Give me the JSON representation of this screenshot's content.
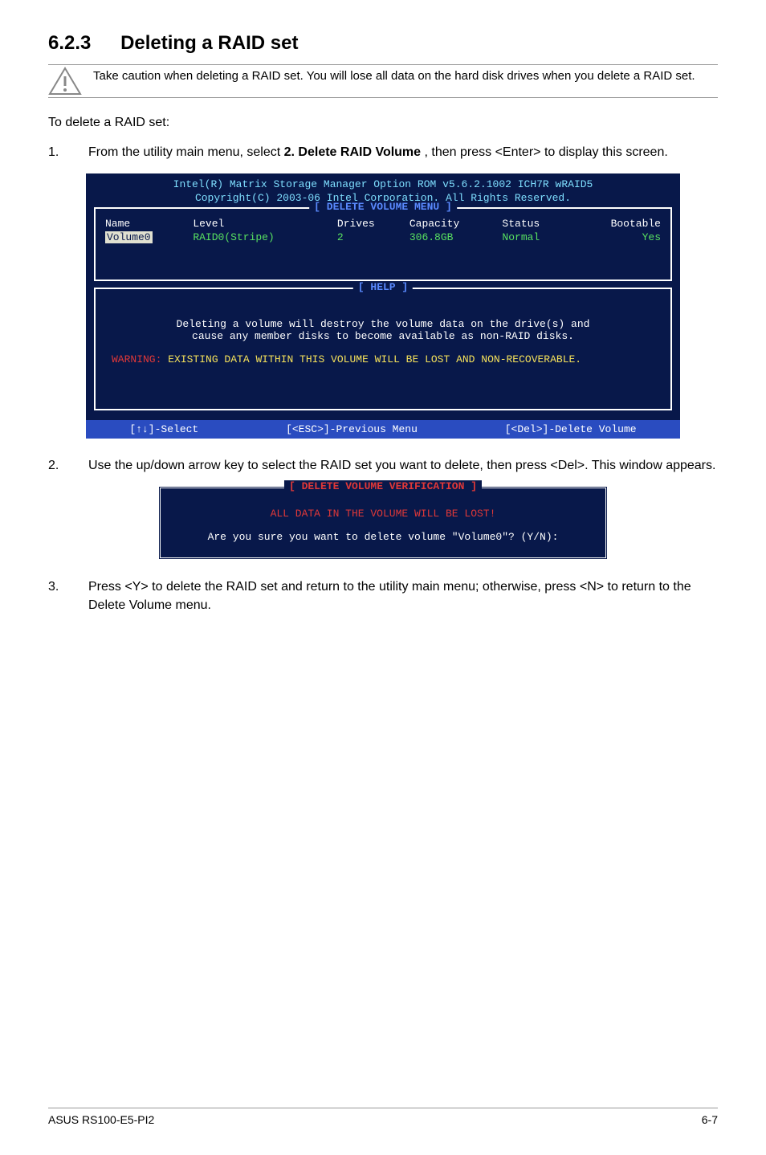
{
  "heading": {
    "number": "6.2.3",
    "title": "Deleting a RAID set"
  },
  "caution": "Take caution when deleting a RAID set. You will lose all data on the hard disk drives when you delete a RAID set.",
  "intro": "To delete a RAID set:",
  "step1": {
    "num": "1.",
    "prefix": "From the utility main menu, select ",
    "bold": "2. Delete RAID Volume",
    "suffix": ", then press <Enter> to display this screen."
  },
  "bios": {
    "title1": "Intel(R) Matrix Storage Manager Option ROM v5.6.2.1002 ICH7R wRAID5",
    "title2": "Copyright(C) 2003-06 Intel Corporation. All Rights Reserved.",
    "section_delete": "[ DELETE VOLUME MENU ]",
    "headers": {
      "name": "Name",
      "level": "Level",
      "drives": "Drives",
      "capacity": "Capacity",
      "status": "Status",
      "bootable": "Bootable"
    },
    "row": {
      "name": "Volume0",
      "level": "RAID0(Stripe)",
      "drives": "2",
      "capacity": "306.8GB",
      "status": "Normal",
      "bootable": "Yes"
    },
    "section_help": "[ HELP ]",
    "help_line1": "Deleting a volume will destroy the volume data on the drive(s) and",
    "help_line2": "cause any member disks to become available as non-RAID disks.",
    "warn_label": "WARNING:",
    "warn_text": " EXISTING DATA WITHIN THIS VOLUME WILL BE LOST AND NON-RECOVERABLE.",
    "footer": {
      "select": "[↑↓]-Select",
      "prev": "[<ESC>]-Previous Menu",
      "del": "[<Del>]-Delete Volume"
    }
  },
  "step2": {
    "num": "2.",
    "text": "Use the up/down arrow key to select the RAID set you want to delete, then press <Del>. This window appears."
  },
  "verify": {
    "title": "[ DELETE VOLUME VERIFICATION ]",
    "warn": "ALL DATA IN THE VOLUME WILL BE LOST!",
    "prompt": "Are you sure you want to delete volume \"Volume0\"? (Y/N):"
  },
  "step3": {
    "num": "3.",
    "text": "Press <Y> to delete the RAID set and return to the utility main menu; otherwise, press <N> to return to the Delete Volume menu."
  },
  "footer": {
    "left": "ASUS RS100-E5-PI2",
    "right": "6-7"
  }
}
